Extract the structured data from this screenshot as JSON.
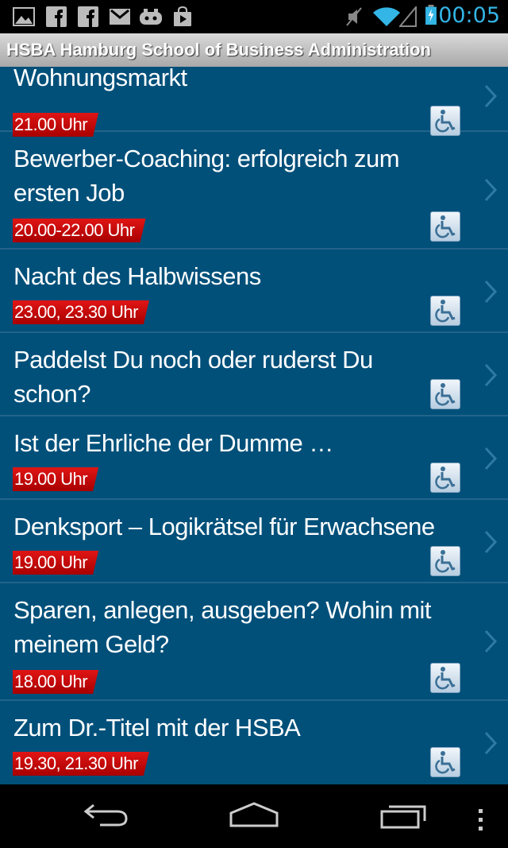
{
  "status_bar": {
    "time": "00:05",
    "icons": [
      "gallery-icon",
      "facebook-icon",
      "facebook-icon",
      "gmail-icon",
      "game-controller-icon",
      "shopping-bag-icon",
      "muted-icon",
      "wifi-icon",
      "signal-icon",
      "battery-charging-icon"
    ]
  },
  "app": {
    "title": "HSBA Hamburg School of Business Administration"
  },
  "events": [
    {
      "title": "Wohnungsmarkt",
      "time": "21.00 Uhr"
    },
    {
      "title": "Bewerber-Coaching: erfolgreich zum ersten Job",
      "time": "20.00-22.00 Uhr"
    },
    {
      "title": "Nacht des Halbwissens",
      "time": "23.00, 23.30 Uhr"
    },
    {
      "title": "Paddelst Du noch oder ruderst Du schon?",
      "time": ""
    },
    {
      "title": "Ist der Ehrliche der Dumme …",
      "time": "19.00 Uhr"
    },
    {
      "title": "Denksport – Logikrätsel für Erwachsene",
      "time": "19.00 Uhr"
    },
    {
      "title": "Sparen, anlegen, ausgeben? Wohin mit meinem Geld?",
      "time": "18.00 Uhr"
    },
    {
      "title": "Zum Dr.-Titel mit der HSBA",
      "time": "19.30, 21.30 Uhr"
    }
  ],
  "nav_bar": {
    "buttons": [
      "back-icon",
      "home-icon",
      "recent-apps-icon",
      "overflow-menu-icon"
    ]
  },
  "colors": {
    "list_bg": "#00507a",
    "divider": "#23648a",
    "time_badge": "#d00000",
    "clock": "#33b5e5"
  }
}
